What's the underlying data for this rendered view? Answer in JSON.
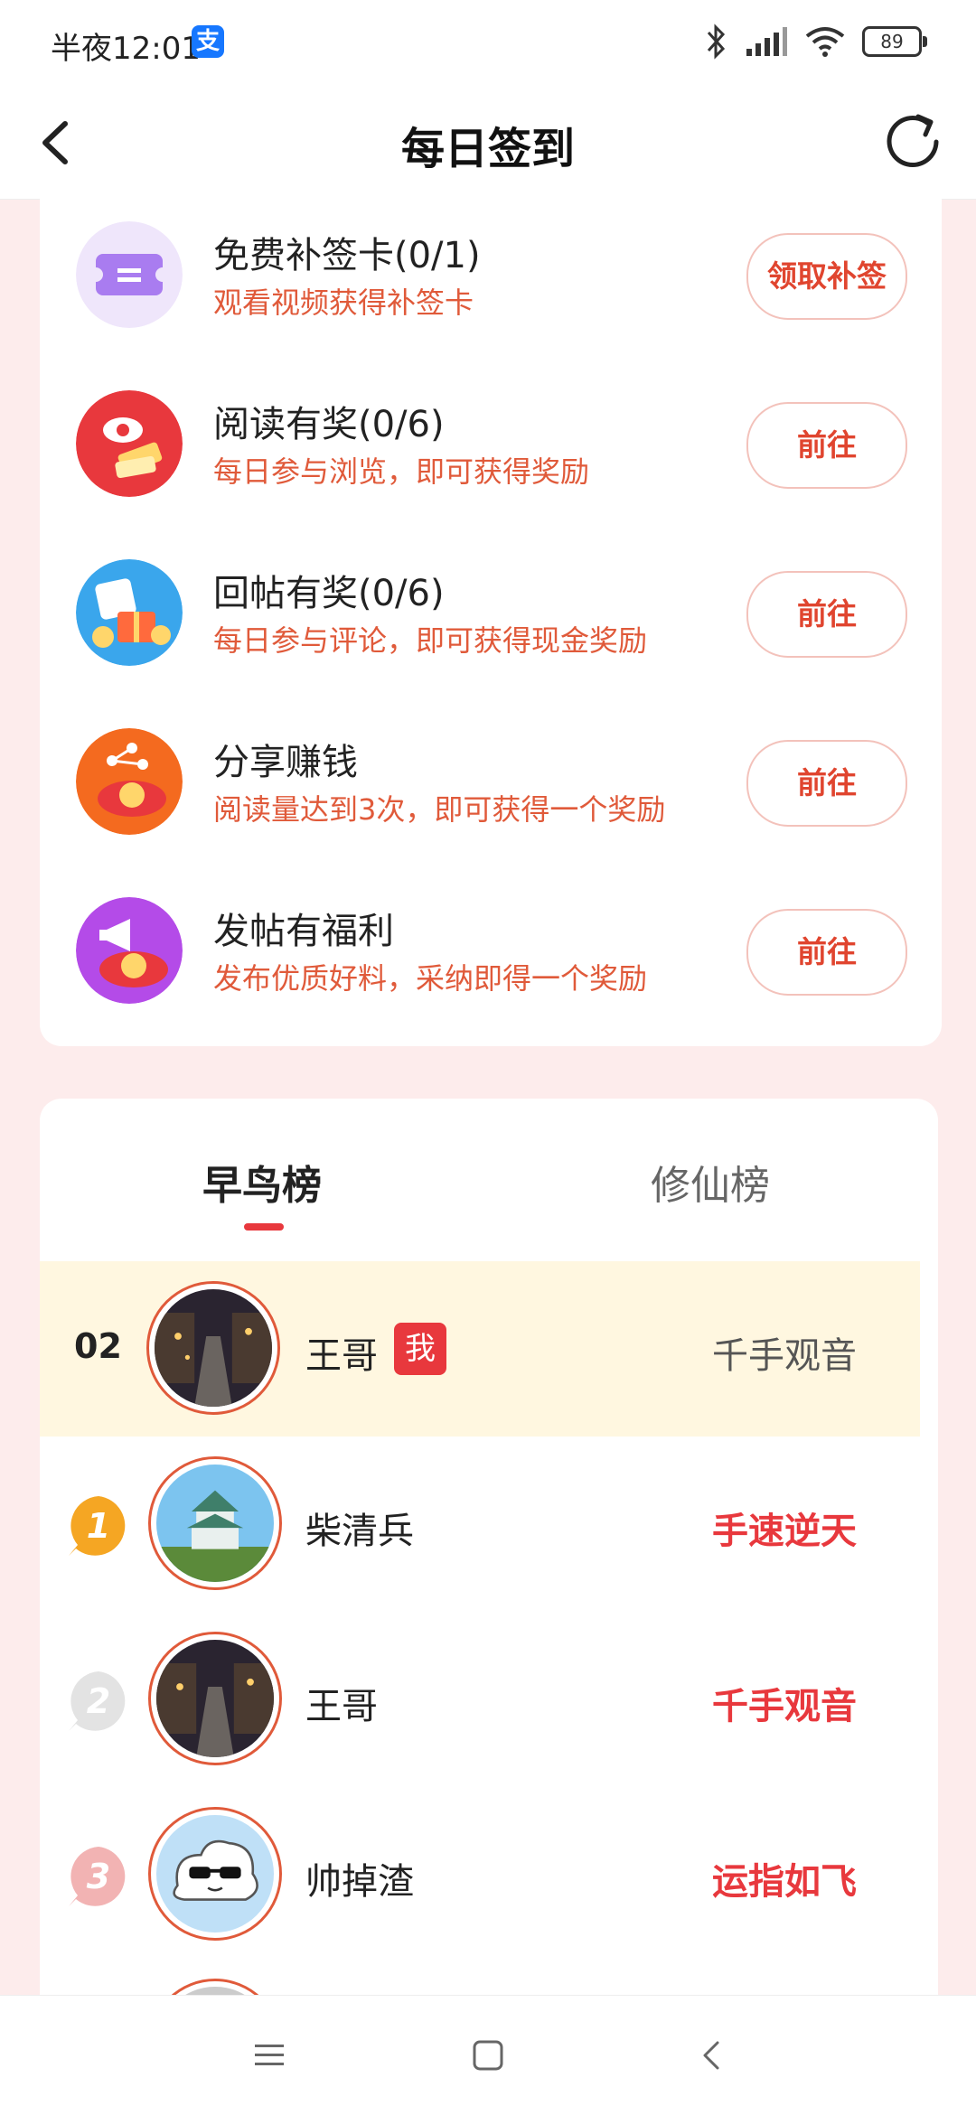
{
  "status_bar": {
    "time": "半夜12:01",
    "alipay_icon": "支",
    "battery": "89"
  },
  "nav": {
    "title": "每日签到"
  },
  "tasks": [
    {
      "icon": "ticket-card-icon",
      "title": "免费补签卡(0/1)",
      "desc": "观看视频获得补签卡",
      "button": "领取补签"
    },
    {
      "icon": "reading-reward-icon",
      "title": "阅读有奖(0/6)",
      "desc": "每日参与浏览，即可获得奖励",
      "button": "前往"
    },
    {
      "icon": "reply-reward-icon",
      "title": "回帖有奖(0/6)",
      "desc": "每日参与评论，即可获得现金奖励",
      "button": "前往"
    },
    {
      "icon": "share-money-icon",
      "title": "分享赚钱",
      "desc": "阅读量达到3次，即可获得一个奖励",
      "button": "前往"
    },
    {
      "icon": "post-welfare-icon",
      "title": "发帖有福利",
      "desc": "发布优质好料，采纳即得一个奖励",
      "button": "前往"
    }
  ],
  "ranking": {
    "tabs": [
      "早鸟榜",
      "修仙榜"
    ],
    "me": {
      "rank": "02",
      "name": "王哥",
      "badge": "我",
      "title": "千手观音"
    },
    "rows": [
      {
        "medal": "1",
        "name": "柴清兵",
        "title": "手速逆天"
      },
      {
        "medal": "2",
        "name": "王哥",
        "title": "千手观音"
      },
      {
        "medal": "3",
        "name": "帅掉渣",
        "title": "运指如飞"
      }
    ]
  },
  "colors": {
    "accent": "#e8383d",
    "desc": "#e05a3a",
    "background": "#fdecec",
    "me_highlight": "#fff7e0"
  }
}
